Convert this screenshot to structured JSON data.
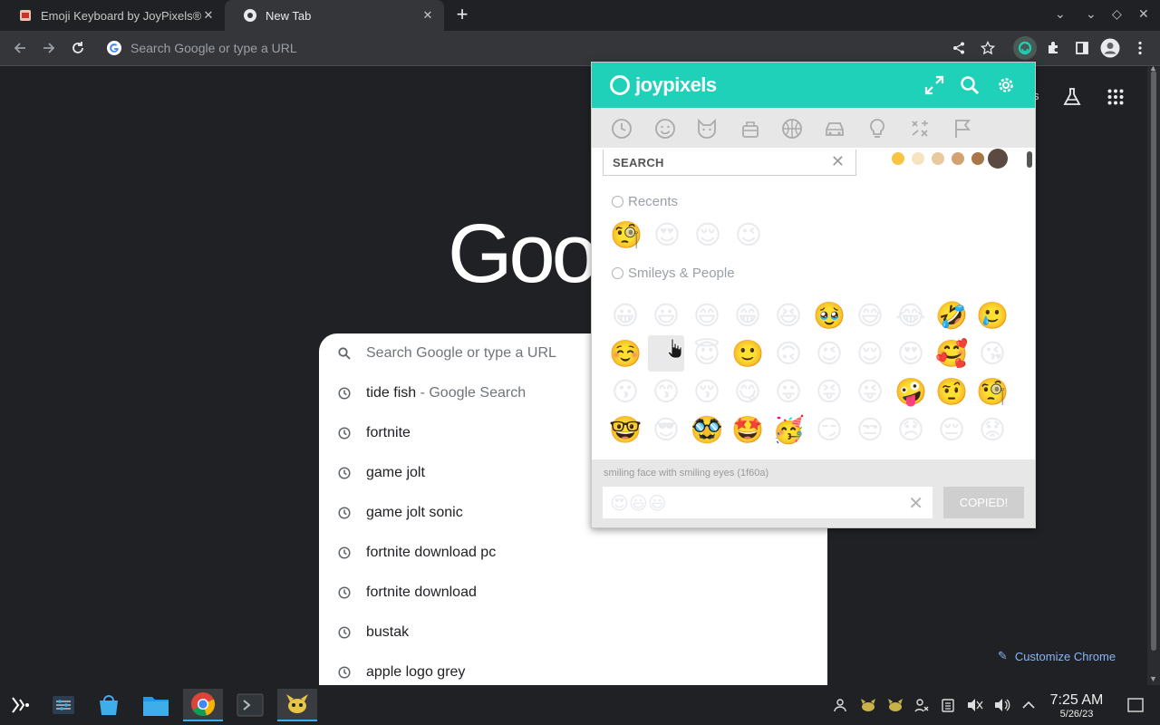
{
  "tabs": [
    {
      "title": "Emoji Keyboard by JoyPixels®",
      "active": false
    },
    {
      "title": "New Tab",
      "active": true
    }
  ],
  "toolbar": {
    "omnibox_placeholder": "Search Google or type a URL"
  },
  "page": {
    "logo_text": "Goog",
    "search_placeholder": "Search Google or type a URL",
    "suggestions": [
      {
        "text": "tide fish",
        "suffix": " - Google Search"
      },
      {
        "text": "fortnite",
        "suffix": ""
      },
      {
        "text": "game jolt",
        "suffix": ""
      },
      {
        "text": "game jolt sonic",
        "suffix": ""
      },
      {
        "text": "fortnite download pc",
        "suffix": ""
      },
      {
        "text": "fortnite download",
        "suffix": ""
      },
      {
        "text": "bustak",
        "suffix": ""
      },
      {
        "text": "apple logo grey",
        "suffix": ""
      }
    ],
    "customize_label": "Customize Chrome",
    "partial_text": "s"
  },
  "joypixels": {
    "brand": "joypixels",
    "search_label": "SEARCH",
    "skin_tones": [
      "#f8c543",
      "#f6e3c2",
      "#e9c99e",
      "#d2a273",
      "#a87647",
      "#5a4a41"
    ],
    "sections": {
      "recents": "Recents",
      "smileys": "Smileys & People"
    },
    "recents": [
      "🧐",
      "😍",
      "😌",
      "😉"
    ],
    "smileys": [
      [
        "😀",
        "😃",
        "😄",
        "😁",
        "😆",
        "🥹",
        "😅",
        "😂",
        "🤣",
        "🥲"
      ],
      [
        "☺️",
        "😊",
        "😇",
        "🙂",
        "🙃",
        "😉",
        "😌",
        "😍",
        "🥰",
        "😘"
      ],
      [
        "😗",
        "😙",
        "😚",
        "😋",
        "😛",
        "😝",
        "😜",
        "🤪",
        "🤨",
        "🧐"
      ],
      [
        "🤓",
        "😎",
        "🥸",
        "🤩",
        "🥳",
        "😏",
        "😒",
        "😞",
        "😔",
        "😟"
      ]
    ],
    "hover_description": "smiling face with smiling eyes (1f60a)",
    "output_value": "😍😃😃",
    "copy_button": "COPIED!",
    "accent_color": "#1fd1b9"
  },
  "taskbar": {
    "time": "7:25 AM",
    "date": "5/26/23"
  }
}
